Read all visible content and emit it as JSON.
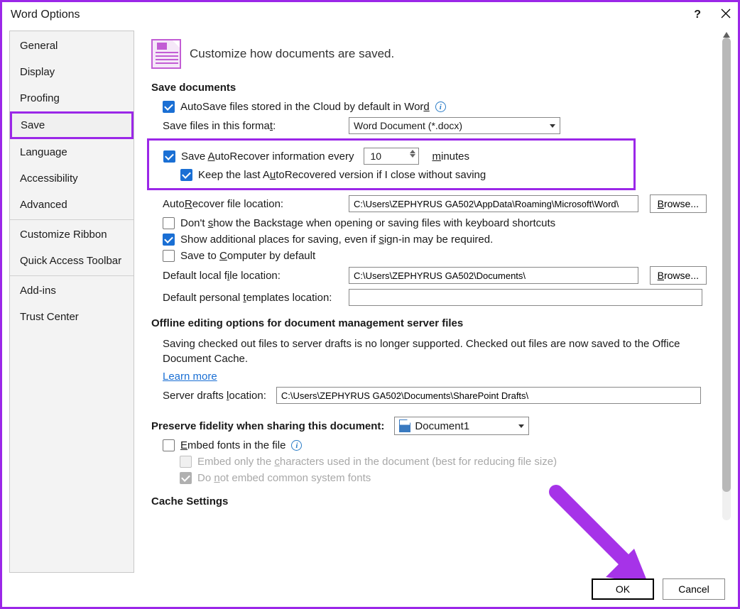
{
  "window": {
    "title": "Word Options"
  },
  "sidebar": {
    "items": [
      {
        "label": "General"
      },
      {
        "label": "Display"
      },
      {
        "label": "Proofing"
      },
      {
        "label": "Save",
        "selected": true
      },
      {
        "label": "Language"
      },
      {
        "label": "Accessibility"
      },
      {
        "label": "Advanced"
      },
      {
        "label": "Customize Ribbon"
      },
      {
        "label": "Quick Access Toolbar"
      },
      {
        "label": "Add-ins"
      },
      {
        "label": "Trust Center"
      }
    ]
  },
  "heading": "Customize how documents are saved.",
  "sections": {
    "save_documents": {
      "title": "Save documents",
      "autosave_cloud": {
        "label_pre": "AutoSave files stored in the Cloud by default in Wor",
        "label_underline": "d",
        "checked": true
      },
      "save_format": {
        "label": "Save files in this forma",
        "label_u": "t",
        "label_post": ":",
        "value": "Word Document (*.docx)"
      },
      "autorecover": {
        "label_pre": "Save ",
        "label_u": "A",
        "label_post": "utoRecover information every",
        "value": "10",
        "unit_u": "m",
        "unit_post": "inutes",
        "checked": true
      },
      "keep_last": {
        "label_pre": "Keep the last A",
        "label_u": "u",
        "label_post": "toRecovered version if I close without saving",
        "checked": true
      },
      "autorecover_loc": {
        "label_pre": "Auto",
        "label_u": "R",
        "label_post": "ecover file location:",
        "value": "C:\\Users\\ZEPHYRUS GA502\\AppData\\Roaming\\Microsoft\\Word\\",
        "browse_u": "B",
        "browse_post": "rowse..."
      },
      "dont_show_backstage": {
        "label_pre": "Don't ",
        "label_u": "s",
        "label_post": "how the Backstage when opening or saving files with keyboard shortcuts",
        "checked": false
      },
      "show_additional": {
        "label_pre": "Show additional places for saving, even if ",
        "label_u": "s",
        "label_post": "ign-in may be required.",
        "checked": true
      },
      "save_computer": {
        "label_pre": "Save to ",
        "label_u": "C",
        "label_post": "omputer by default",
        "checked": false
      },
      "default_local": {
        "label_pre": "Default local f",
        "label_u": "i",
        "label_post": "le location:",
        "value": "C:\\Users\\ZEPHYRUS GA502\\Documents\\",
        "browse_u": "B",
        "browse_post": "rowse..."
      },
      "default_templates": {
        "label_pre": "Default personal ",
        "label_u": "t",
        "label_post": "emplates location:",
        "value": ""
      }
    },
    "offline": {
      "title": "Offline editing options for document management server files",
      "note": "Saving checked out files to server drafts is no longer supported. Checked out files are now saved to the Office Document Cache.",
      "learn_more": "Learn more",
      "server_drafts": {
        "label_pre": "Server drafts ",
        "label_u": "l",
        "label_post": "ocation:",
        "value": "C:\\Users\\ZEPHYRUS GA502\\Documents\\SharePoint Drafts\\"
      }
    },
    "preserve": {
      "title": "Preserve fidelity when sharing this document:",
      "doc": "Document1",
      "embed_fonts": {
        "label_u": "E",
        "label_post": "mbed fonts in the file",
        "checked": false
      },
      "embed_chars": {
        "label_pre": "Embed only the ",
        "label_u": "c",
        "label_post": "haracters used in the document (best for reducing file size)",
        "checked": false
      },
      "no_common": {
        "label_pre": "Do ",
        "label_u": "n",
        "label_post": "ot embed common system fonts",
        "checked": true
      }
    },
    "cache": {
      "title": "Cache Settings"
    }
  },
  "footer": {
    "ok": "OK",
    "cancel": "Cancel"
  }
}
